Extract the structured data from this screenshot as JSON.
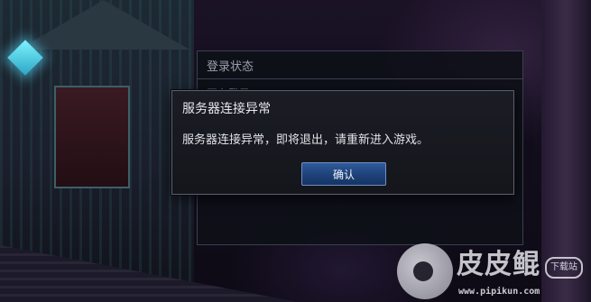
{
  "background_panel": {
    "title": "登录状态",
    "subtitle": "正在登录"
  },
  "dialog": {
    "title": "服务器连接异常",
    "message": "服务器连接异常，即将退出，请重新进入游戏。",
    "confirm_label": "确认"
  },
  "watermark": {
    "brand": "皮皮鲲",
    "badge": "下载站",
    "url": "www.pipikun.com"
  },
  "colors": {
    "dialog_bg": "#1b1d24",
    "dialog_border": "#5b6070",
    "button_accent": "#2f5b9a"
  }
}
